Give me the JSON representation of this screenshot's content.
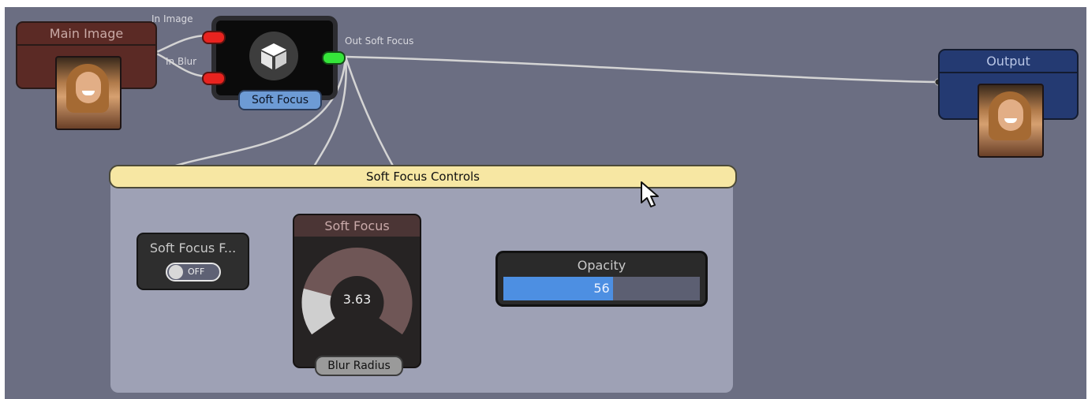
{
  "nodes": {
    "main_image": {
      "title": "Main Image"
    },
    "soft_focus": {
      "label": "Soft Focus",
      "inputs": [
        "In Image",
        "In Blur"
      ],
      "output": "Out Soft Focus"
    },
    "output": {
      "title": "Output"
    }
  },
  "controls": {
    "header": "Soft Focus Controls",
    "toggle": {
      "title": "Soft Focus F...",
      "state": "OFF"
    },
    "dial": {
      "title": "Soft Focus",
      "value": "3.63",
      "label": "Blur Radius",
      "level": 0.2
    },
    "opacity": {
      "title": "Opacity",
      "value": "56",
      "level": 0.56
    }
  },
  "colors": {
    "canvas": "#6b6e82",
    "main_image": "#5b2a25",
    "output": "#243a72",
    "port_in": "#e8231f",
    "port_out": "#35e53a",
    "header": "#f7e7a3",
    "slider_fill": "#4d8fe2"
  }
}
